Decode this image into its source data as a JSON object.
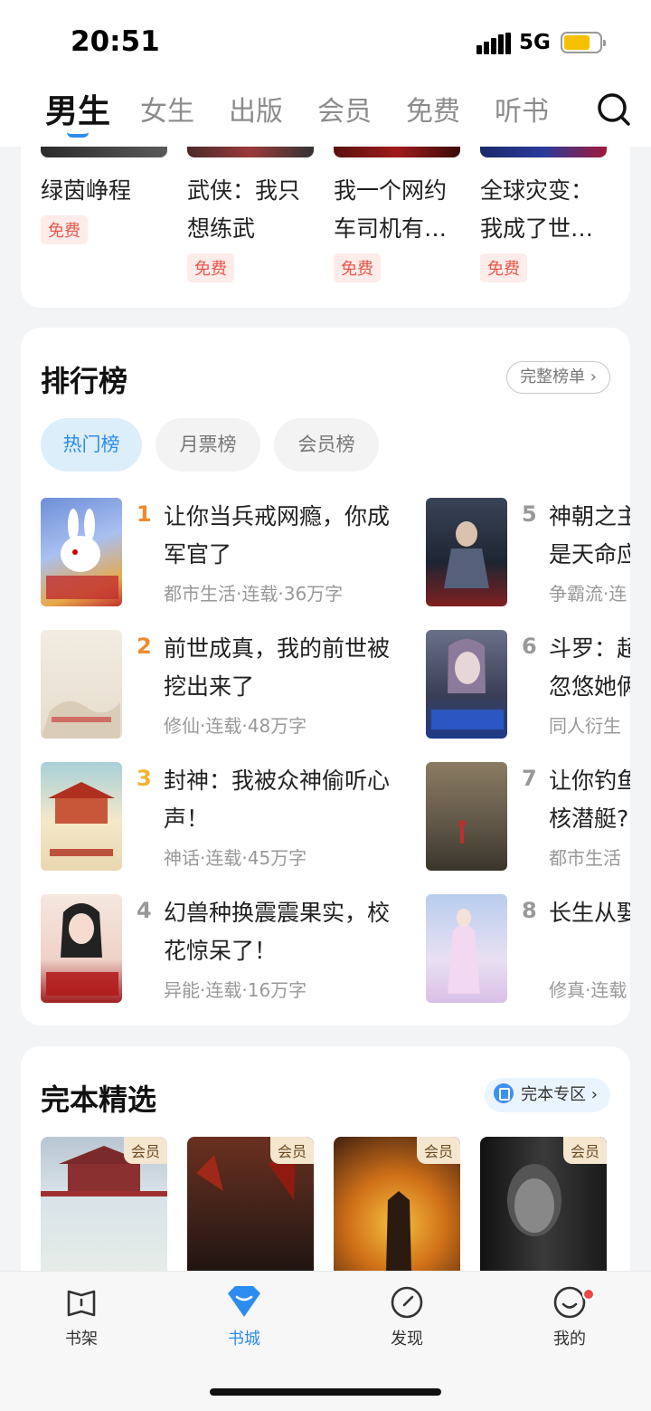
{
  "status_bar": {
    "time": "20:51",
    "network": "5G"
  },
  "top_tabs": [
    "男生",
    "女生",
    "出版",
    "会员",
    "免费",
    "听书"
  ],
  "featured_books": [
    {
      "title": "绿茵峥程",
      "badge": "免费"
    },
    {
      "title": "武侠：我只想练武",
      "badge": "免费"
    },
    {
      "title": "我一个网约车司机有…",
      "badge": "免费"
    },
    {
      "title": "全球灾变：我成了世…",
      "badge": "免费"
    }
  ],
  "ranking": {
    "title": "排行榜",
    "more_label": "完整榜单 ›",
    "tabs": [
      "热门榜",
      "月票榜",
      "会员榜"
    ],
    "items": [
      {
        "rank": "1",
        "title": "让你当兵戒网瘾，你成军官了",
        "meta": "都市生活·连载·36万字"
      },
      {
        "rank": "2",
        "title": "前世成真，我的前世被挖出来了",
        "meta": "修仙·连载·48万字"
      },
      {
        "rank": "3",
        "title": "封神：我被众神偷听心声！",
        "meta": "神话·连载·45万字"
      },
      {
        "rank": "4",
        "title": "幻兽种换震震果实，校花惊呆了！",
        "meta": "异能·连载·16万字"
      },
      {
        "rank": "5",
        "title": "神朝之主是天命应",
        "meta": "争霸流·连"
      },
      {
        "rank": "6",
        "title": "斗罗：超忽悠她俩",
        "meta": "同人衍生"
      },
      {
        "rank": "7",
        "title": "让你钓鱼核潜艇?",
        "meta": "都市生活"
      },
      {
        "rank": "8",
        "title": "长生从娶",
        "meta": "修真·连载"
      }
    ]
  },
  "complete": {
    "title": "完本精选",
    "more_label": "完本专区 ›",
    "badge": "会员"
  },
  "bottom_nav": [
    "书架",
    "书城",
    "发现",
    "我的"
  ],
  "colors": {
    "accent": "#2d8cf0",
    "free_red": "#e8574a",
    "rank_top": "#f08a2c"
  }
}
